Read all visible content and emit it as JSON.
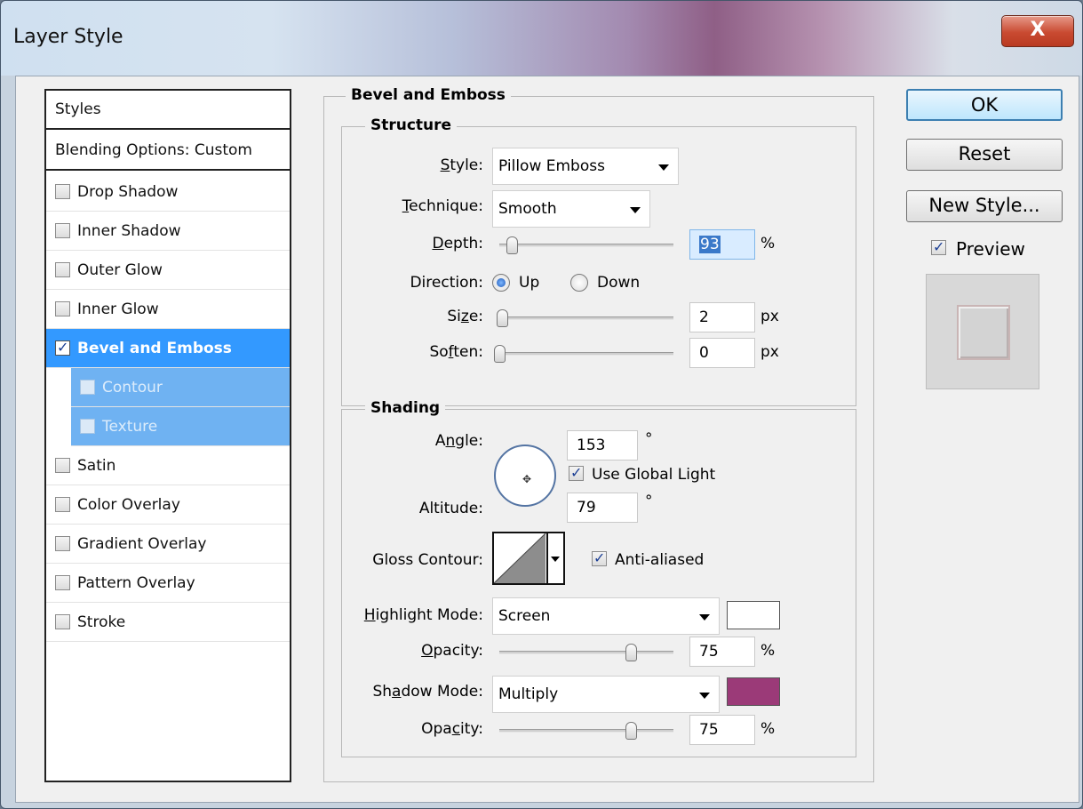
{
  "window": {
    "title": "Layer Style",
    "close_label": "X"
  },
  "styles": {
    "header": "Styles",
    "blending": "Blending Options: Custom",
    "items": [
      {
        "label": "Drop Shadow",
        "checked": false
      },
      {
        "label": "Inner Shadow",
        "checked": false
      },
      {
        "label": "Outer Glow",
        "checked": false
      },
      {
        "label": "Inner Glow",
        "checked": false
      },
      {
        "label": "Bevel and Emboss",
        "checked": true
      },
      {
        "label": "Contour",
        "checked": false
      },
      {
        "label": "Texture",
        "checked": false
      },
      {
        "label": "Satin",
        "checked": false
      },
      {
        "label": "Color Overlay",
        "checked": false
      },
      {
        "label": "Gradient Overlay",
        "checked": false
      },
      {
        "label": "Pattern Overlay",
        "checked": false
      },
      {
        "label": "Stroke",
        "checked": false
      }
    ]
  },
  "bevel": {
    "section": "Bevel and Emboss",
    "structure": {
      "label": "Structure",
      "style_label": "Style:",
      "style_value": "Pillow Emboss",
      "technique_label": "Technique:",
      "technique_value": "Smooth",
      "depth_label": "Depth:",
      "depth_value": "93",
      "depth_unit": "%",
      "direction_label": "Direction:",
      "direction_up": "Up",
      "direction_down": "Down",
      "size_label": "Size:",
      "size_value": "2",
      "size_unit": "px",
      "soften_label": "Soften:",
      "soften_value": "0",
      "soften_unit": "px"
    },
    "shading": {
      "label": "Shading",
      "angle_label": "Angle:",
      "angle_value": "153",
      "angle_unit": "°",
      "use_global_light": "Use Global Light",
      "altitude_label": "Altitude:",
      "altitude_value": "79",
      "altitude_unit": "°",
      "gloss_contour_label": "Gloss Contour:",
      "anti_aliased": "Anti-aliased",
      "highlight_mode_label": "Highlight Mode:",
      "highlight_mode_value": "Screen",
      "highlight_color": "#ffffff",
      "highlight_opacity_label": "Opacity:",
      "highlight_opacity_value": "75",
      "highlight_opacity_unit": "%",
      "shadow_mode_label": "Shadow Mode:",
      "shadow_mode_value": "Multiply",
      "shadow_color": "#9b3a78",
      "shadow_opacity_label": "Opacity:",
      "shadow_opacity_value": "75",
      "shadow_opacity_unit": "%"
    }
  },
  "buttons": {
    "ok": "OK",
    "reset": "Reset",
    "new_style": "New Style...",
    "preview": "Preview"
  }
}
